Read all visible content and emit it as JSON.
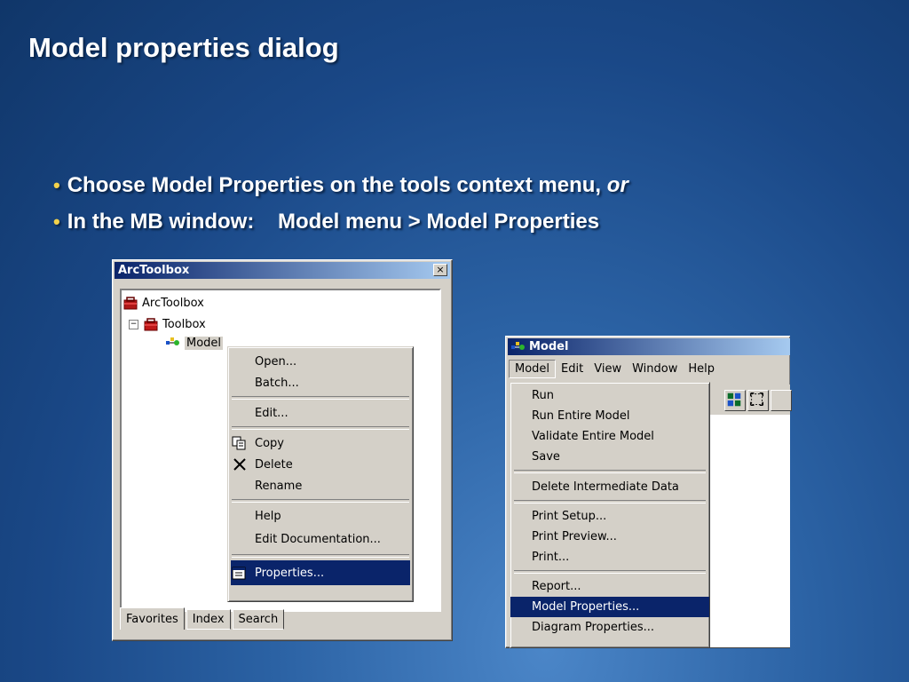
{
  "slide": {
    "title": "Model properties dialog",
    "bullets": [
      {
        "text": "Choose Model Properties on the tools context menu,",
        "emphasis": "or"
      },
      {
        "text": "In the MB window:    Model menu > Model Properties",
        "emphasis": ""
      }
    ]
  },
  "arctoolbox": {
    "title": "ArcToolbox",
    "close_glyph": "×",
    "tree": [
      "ArcToolbox",
      "Toolbox",
      "Model"
    ],
    "tree_expander": "−",
    "context_menu": {
      "items": [
        "Open...",
        "Batch...",
        "Edit...",
        "Copy",
        "Delete",
        "Rename",
        "Help",
        "Edit Documentation...",
        "Properties..."
      ],
      "highlighted": "Properties..."
    },
    "tabs": [
      "Favorites",
      "Index",
      "Search"
    ]
  },
  "model_window": {
    "title": "Model",
    "menubar": [
      "Model",
      "Edit",
      "View",
      "Window",
      "Help"
    ],
    "open_menu": "Model",
    "menu_items": [
      "Run",
      "Run Entire Model",
      "Validate Entire Model",
      "Save",
      "Delete Intermediate Data",
      "Print Setup...",
      "Print Preview...",
      "Print...",
      "Report...",
      "Model Properties...",
      "Diagram Properties..."
    ],
    "highlighted": "Model Properties..."
  },
  "colors": {
    "highlight": "#0a246a",
    "bullet": "#f3d24b",
    "face": "#d4d0c8"
  }
}
